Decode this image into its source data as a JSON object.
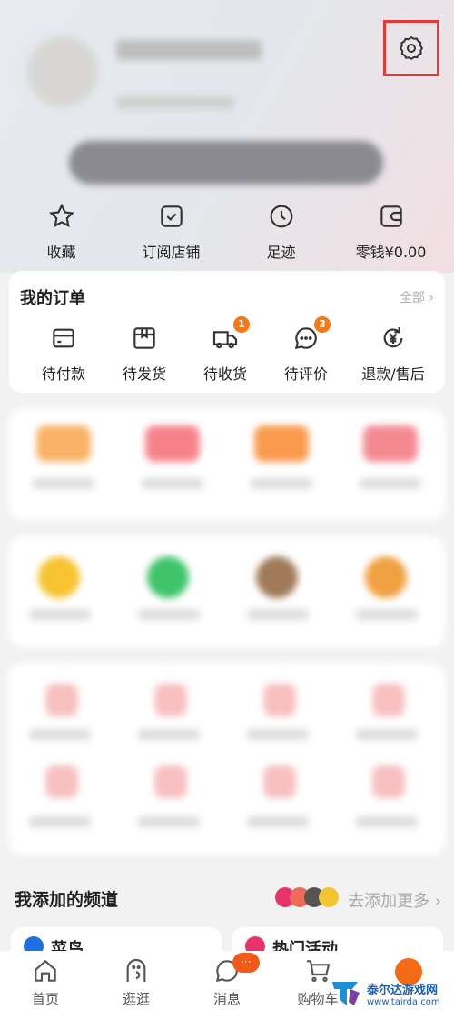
{
  "header": {
    "settings_icon": "gear-icon",
    "highlight_color": "#e53935"
  },
  "quick_links": [
    {
      "label": "收藏",
      "icon": "star-icon"
    },
    {
      "label": "订阅店铺",
      "icon": "checkbox-icon"
    },
    {
      "label": "足迹",
      "icon": "clock-icon"
    },
    {
      "label": "零钱¥0.00",
      "icon": "wallet-icon"
    }
  ],
  "orders": {
    "title": "我的订单",
    "all": "全部 ›",
    "items": [
      {
        "label": "待付款",
        "icon": "card-icon",
        "badge": null
      },
      {
        "label": "待发货",
        "icon": "box-icon",
        "badge": null
      },
      {
        "label": "待收货",
        "icon": "truck-icon",
        "badge": "1"
      },
      {
        "label": "待评价",
        "icon": "chat-icon",
        "badge": "3"
      },
      {
        "label": "退款/售后",
        "icon": "yen-refund-icon",
        "badge": null
      }
    ]
  },
  "channels": {
    "title": "我添加的频道",
    "more": "去添加更多 ›",
    "cards": [
      {
        "label": "菜鸟"
      },
      {
        "label": "热门活动"
      }
    ]
  },
  "bottom_nav": [
    {
      "label": "首页"
    },
    {
      "label": "逛逛"
    },
    {
      "label": "消息",
      "badge": "···"
    },
    {
      "label": "购物车"
    }
  ],
  "watermark": {
    "text": "泰尔达游戏网",
    "url_text": "www.tairda.com"
  },
  "accent": "#f47a17"
}
